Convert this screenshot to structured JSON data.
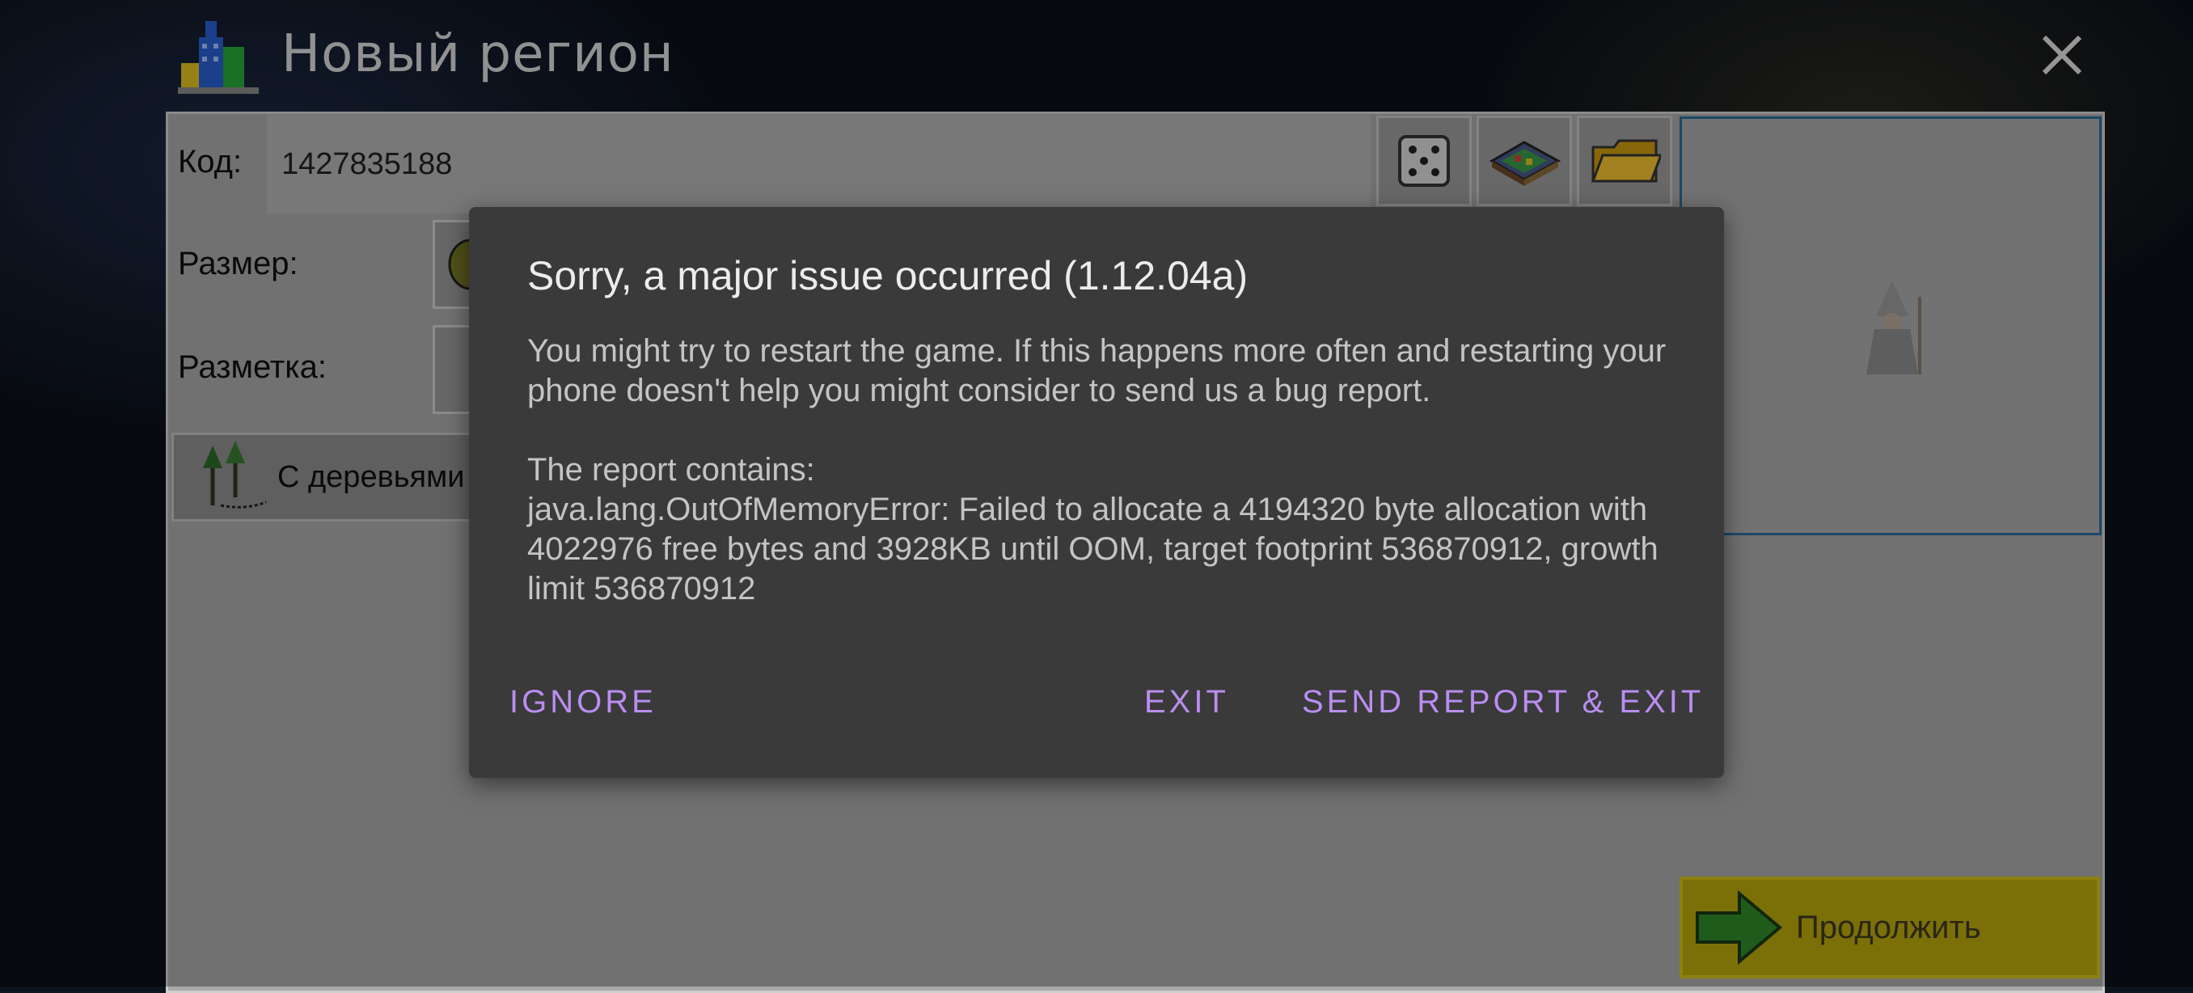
{
  "window": {
    "title": "Новый регион"
  },
  "form": {
    "code_label": "Код:",
    "code_value": "1427835188",
    "size_label": "Размер:",
    "markup_label": "Разметка:",
    "trees_label": "С деревьями",
    "continue_label": "Продолжить"
  },
  "dialog": {
    "title": "Sorry, a major issue occurred (1.12.04a)",
    "message": "You might try to restart the game. If this happens more often and restarting your phone doesn't help you might consider to send us a bug report.",
    "report_heading": "The report contains:",
    "report_text": "java.lang.OutOfMemoryError: Failed to allocate a 4194320 byte allocation with 4022976 free bytes and 3928KB until OOM, target footprint 536870912, growth limit 536870912",
    "buttons": {
      "ignore": "IGNORE",
      "exit": "EXIT",
      "send_report_exit": "SEND REPORT & EXIT"
    }
  },
  "colors": {
    "dialog_bg": "#3a3a3a",
    "dialog_button": "#b98ef2",
    "continue_button": "#b8a70c",
    "preview_border": "#2b6d9c"
  },
  "icons": [
    "city-icon",
    "close-icon",
    "dice-icon",
    "map-book-icon",
    "folder-icon",
    "wizard-icon",
    "trees-icon",
    "arrow-right-icon",
    "globe-icon"
  ]
}
